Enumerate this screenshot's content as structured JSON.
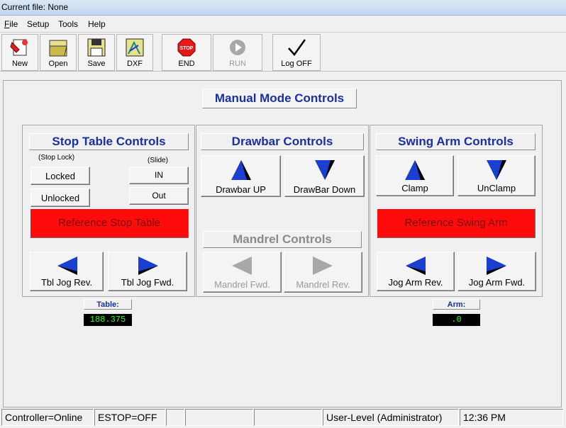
{
  "window": {
    "title": "Current file: None"
  },
  "menu": [
    {
      "label": "File",
      "accel": "F",
      "rest": "ile"
    },
    {
      "label": "Setup",
      "accel": "",
      "rest": "Setup"
    },
    {
      "label": "Tools",
      "accel": "",
      "rest": "Tools"
    },
    {
      "label": "Help",
      "accel": "",
      "rest": "Help"
    }
  ],
  "toolbar": {
    "new": "New",
    "open": "Open",
    "save": "Save",
    "dxf": "DXF",
    "end": "END",
    "end_sign": "STOP",
    "run": "RUN",
    "logoff": "Log OFF"
  },
  "main": {
    "title": "Manual Mode Controls"
  },
  "stop_table": {
    "header": "Stop Table Controls",
    "stop_lock_label": "(Stop Lock)",
    "slide_label": "(Slide)",
    "locked": "Locked",
    "unlocked": "Unlocked",
    "in": "IN",
    "out": "Out",
    "reference": "Reference Stop Table",
    "jog_rev": "Tbl Jog Rev.",
    "jog_fwd": "Tbl Jog Fwd."
  },
  "drawbar": {
    "header": "Drawbar Controls",
    "up": "Drawbar UP",
    "down": "DrawBar Down"
  },
  "mandrel": {
    "header": "Mandrel Controls",
    "fwd": "Mandrel Fwd.",
    "rev": "Mandrel Rev."
  },
  "swing_arm": {
    "header": "Swing Arm Controls",
    "clamp": "Clamp",
    "unclamp": "UnClamp",
    "reference": "Reference Swing Arm",
    "jog_rev": "Jog Arm Rev.",
    "jog_fwd": "Jog Arm Fwd."
  },
  "readouts": {
    "table_label": "Table:",
    "table_value": "188.375",
    "arm_label": "Arm:",
    "arm_value": ".0"
  },
  "status": {
    "controller": "Controller=Online",
    "estop": "ESTOP=OFF",
    "user": "User-Level (Administrator)",
    "time": "12:36 PM"
  },
  "colors": {
    "accent_text": "#1a2fa0",
    "reference_button": "#ff0b0b",
    "arrow_blue": "#1a3fd0",
    "readout_text": "#2bff2b"
  }
}
